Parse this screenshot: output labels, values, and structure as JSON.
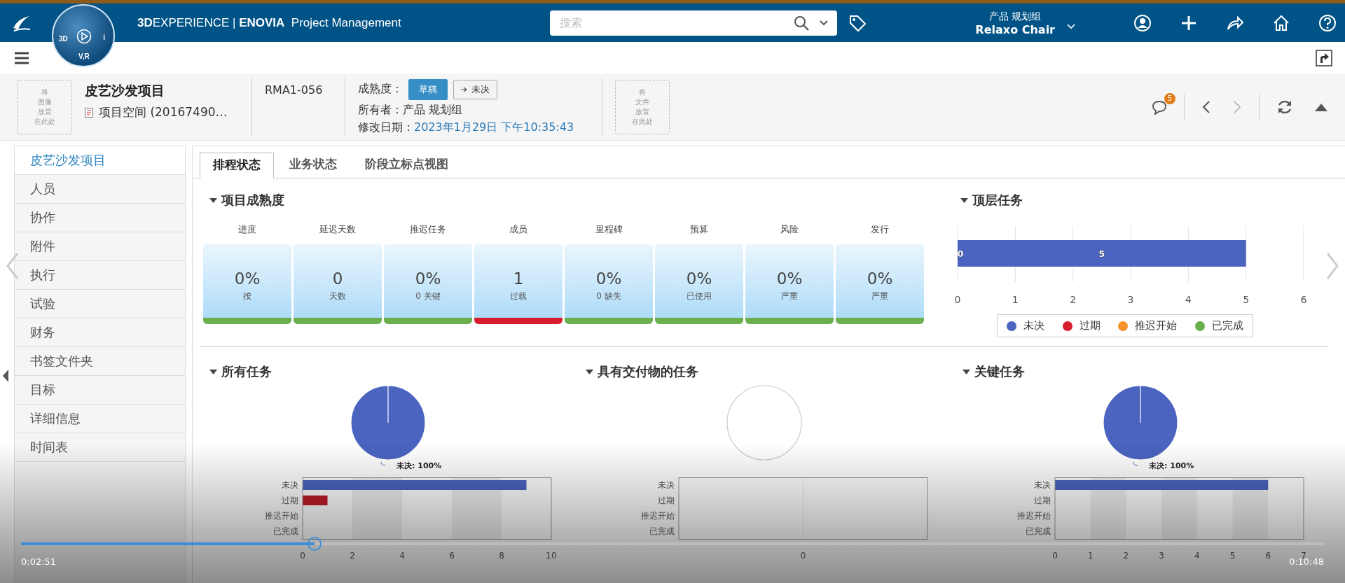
{
  "app_bar": {
    "compass_labels": [
      "3D",
      "i",
      "V,R"
    ],
    "title": "**3D**EXPERIENCE | **ENOVIA**  Project Management",
    "search": {
      "placeholder": "搜索"
    },
    "context": {
      "group": "产品 规划组",
      "name": "Relaxo Chair"
    }
  },
  "header": {
    "image_drop": [
      "将",
      "图像",
      "放置",
      "在此处"
    ],
    "title": "皮艺沙发项目",
    "subtitle": "项目空间 (20167490…",
    "code": "RMA1-056",
    "maturity_label": "成熟度：",
    "maturity_buttons": [
      {
        "kind": "state",
        "label": "草稿",
        "selected": true
      },
      {
        "kind": "promote",
        "label": "未决",
        "selected": false
      }
    ],
    "owner": "所有者：产品 规划组",
    "modified_label": "修改日期：",
    "modified_value": "2023年1月29日 下午10:35:43",
    "file_drop": [
      "将",
      "文件",
      "放置",
      "在此处"
    ],
    "notification_count": "5",
    "prev_disabled": false,
    "next_disabled": true
  },
  "sidebar": {
    "items": [
      {
        "label": "皮艺沙发项目",
        "selected": true
      },
      {
        "label": "人员",
        "selected": false
      },
      {
        "label": "协作",
        "selected": false
      },
      {
        "label": "附件",
        "selected": false
      },
      {
        "label": "执行",
        "selected": false
      },
      {
        "label": "试验",
        "selected": false
      },
      {
        "label": "财务",
        "selected": false
      },
      {
        "label": "书签文件夹",
        "selected": false
      },
      {
        "label": "目标",
        "selected": false
      },
      {
        "label": "详细信息",
        "selected": false
      },
      {
        "label": "时间表",
        "selected": false
      }
    ]
  },
  "tabs": [
    {
      "label": "排程状态",
      "selected": true
    },
    {
      "label": "业务状态",
      "selected": false
    },
    {
      "label": "阶段立标点视图",
      "selected": false
    }
  ],
  "maturity": {
    "title": "项目成熟度",
    "tiles": [
      {
        "label": "进度",
        "value": "0%",
        "sub": "按",
        "color": "#6ab04c"
      },
      {
        "label": "延迟天数",
        "value": "0",
        "sub": "天数",
        "color": "#6ab04c"
      },
      {
        "label": "推迟任务",
        "value": "0%",
        "sub": "0 关键",
        "color": "#6ab04c"
      },
      {
        "label": "成员",
        "value": "1",
        "sub": "过载",
        "color": "#d81e2e"
      },
      {
        "label": "里程碑",
        "value": "0%",
        "sub": "0 缺失",
        "color": "#6ab04c"
      },
      {
        "label": "预算",
        "value": "0%",
        "sub": "已使用",
        "color": "#6ab04c"
      },
      {
        "label": "风险",
        "value": "0%",
        "sub": "严重",
        "color": "#6ab04c"
      },
      {
        "label": "发行",
        "value": "0%",
        "sub": "严重",
        "color": "#6ab04c"
      }
    ]
  },
  "top_tasks": {
    "title": "顶层任务",
    "chart_data": {
      "type": "bar",
      "orientation": "horizontal",
      "grid": true,
      "xlim": [
        0,
        6
      ],
      "xticks": [
        0,
        1,
        2,
        3,
        4,
        5,
        6
      ],
      "series": [
        {
          "name": "未决",
          "color": "#4a64bf",
          "values": [
            5
          ]
        },
        {
          "name": "过期",
          "color": "#d81e2e",
          "values": [
            0
          ]
        },
        {
          "name": "推迟开始",
          "color": "#f7912a",
          "values": [
            0
          ]
        },
        {
          "name": "已完成",
          "color": "#6ab04c",
          "values": [
            0
          ]
        }
      ],
      "value_labels": [
        "0",
        "5"
      ]
    }
  },
  "panels": [
    {
      "title": "所有任务",
      "pie_chart": {
        "chart_data": {
          "type": "pie",
          "categories": [
            "未决: 100%"
          ],
          "values": [
            100
          ]
        }
      },
      "bar_chart": {
        "chart_data": {
          "type": "bar",
          "orientation": "horizontal",
          "categories": [
            "未决",
            "过期",
            "推迟开始",
            "已完成"
          ],
          "xlim": [
            0,
            10
          ],
          "xticks": [
            0,
            2,
            4,
            6,
            8,
            10
          ],
          "series": [
            {
              "color": "#4a64bf",
              "values": [
                9,
                0,
                0,
                0
              ]
            },
            {
              "color": "#c01c28",
              "values": [
                0,
                1,
                0,
                0
              ]
            }
          ]
        }
      }
    },
    {
      "title": "具有交付物的任务",
      "bar_chart": {
        "chart_data": {
          "type": "other",
          "categories": [
            "未决",
            "过期",
            "推迟开始",
            "已完成"
          ],
          "annotations": [
            "0"
          ]
        }
      }
    },
    {
      "title": "关键任务",
      "pie_chart": {
        "chart_data": {
          "type": "pie",
          "categories": [
            "未决: 100%"
          ],
          "values": [
            100
          ]
        }
      },
      "bar_chart": {
        "chart_data": {
          "type": "bar",
          "orientation": "horizontal",
          "categories": [
            "未决",
            "过期",
            "推迟开始",
            "已完成"
          ],
          "xlim": [
            0,
            7
          ],
          "xticks": [
            0,
            1,
            2,
            3,
            4,
            5,
            6,
            7
          ],
          "series": [
            {
              "color": "#4a64bf",
              "values": [
                6,
                0,
                0,
                0
              ]
            }
          ]
        }
      }
    }
  ],
  "video": {
    "elapsed": "0:02:51",
    "duration": "0:10:48",
    "level": 0.225
  }
}
